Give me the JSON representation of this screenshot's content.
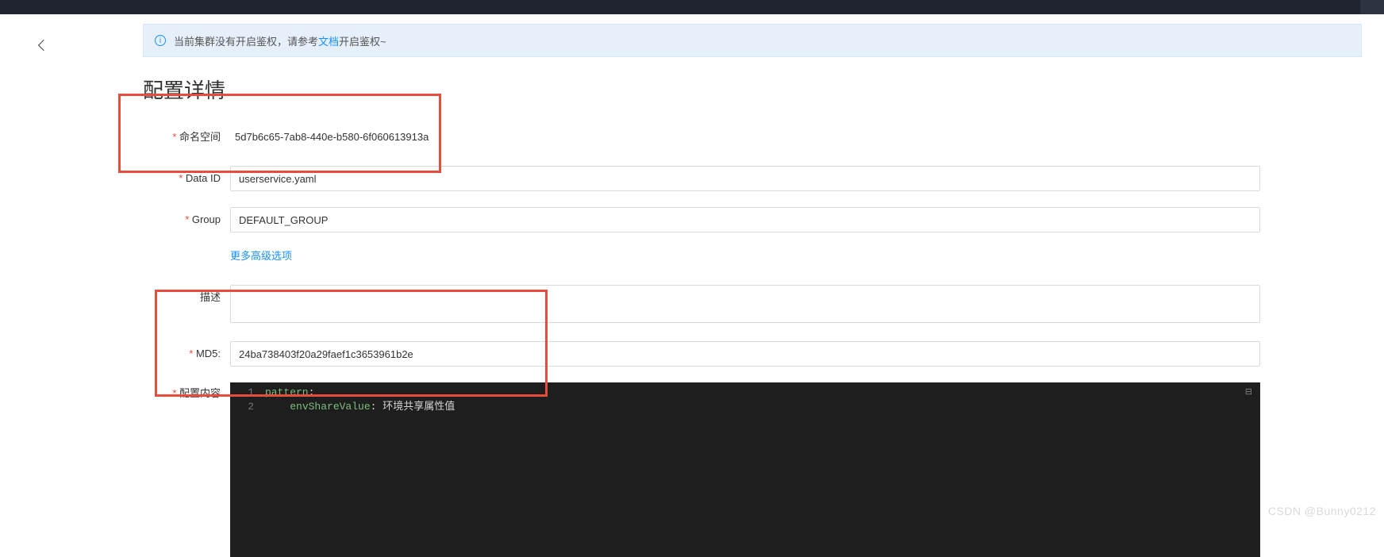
{
  "alert": {
    "prefix": "当前集群没有开启鉴权，请参考",
    "link_text": "文档",
    "suffix": "开启鉴权~"
  },
  "page_title": "配置详情",
  "form": {
    "namespace": {
      "label": "命名空间",
      "value": "5d7b6c65-7ab8-440e-b580-6f060613913a"
    },
    "data_id": {
      "label": "Data ID",
      "value": "userservice.yaml"
    },
    "group": {
      "label": "Group",
      "value": "DEFAULT_GROUP"
    },
    "advanced_link": "更多高级选项",
    "desc": {
      "label": "描述",
      "value": ""
    },
    "md5": {
      "label": "MD5:",
      "value": "24ba738403f20a29faef1c3653961b2e"
    },
    "content": {
      "label": "配置内容"
    }
  },
  "code": {
    "line1_key": "pattern",
    "line2_indent": "    ",
    "line2_key": "envShareValue",
    "line2_val": "环境共享属性值"
  },
  "watermark": "CSDN @Bunny0212"
}
